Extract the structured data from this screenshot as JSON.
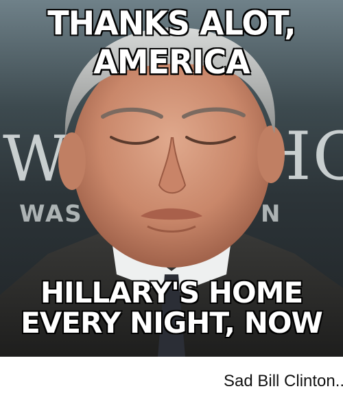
{
  "meme": {
    "top_caption": "THANKS ALOT, AMERICA",
    "bottom_caption_line1": "HILLARY'S HOME",
    "bottom_caption_line2": "EVERY NIGHT, NOW",
    "background_sign_left": "WH",
    "background_sign_right": "HO",
    "background_sign_small_left": "WAS",
    "background_sign_small_right": "N"
  },
  "post": {
    "caption": "Sad Bill Clinton..."
  }
}
